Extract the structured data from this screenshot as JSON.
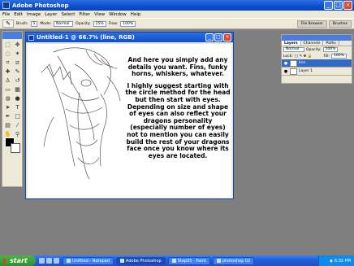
{
  "app": {
    "title": "Adobe Photoshop"
  },
  "menu": [
    "File",
    "Edit",
    "Image",
    "Layer",
    "Select",
    "Filter",
    "View",
    "Window",
    "Help"
  ],
  "options": {
    "brush_label": "Brush:",
    "brush_size": "5",
    "mode_label": "Mode:",
    "mode_value": "Normal",
    "opacity_label": "Opacity:",
    "opacity_value": "25%",
    "flow_label": "Flow:",
    "flow_value": "100%",
    "well_tabs": [
      "File Browser",
      "Brushes"
    ]
  },
  "document": {
    "title": "Untitled-1 @ 66.7% (line, RGB)",
    "paragraphs": [
      "And here you simply add any details you want. Fins, funky horns, whiskers, whatever.",
      "I highly suggest starting with the circle method for the head but then start with eyes. Depending on size and shape of eyes can also reflect your dragons personality (especially number of eyes)  not to mention you can easily build the rest of your dragons face once you know where its eyes are located."
    ]
  },
  "layers": {
    "tabs": [
      "Layers",
      "Channels",
      "Paths"
    ],
    "blend_mode": "Normal",
    "opacity_label": "Opacity:",
    "opacity_value": "100%",
    "lock_label": "Lock:",
    "fill_label": "Fill:",
    "fill_value": "100%",
    "items": [
      {
        "name": "line",
        "selected": true
      },
      {
        "name": "Layer 1",
        "selected": false
      }
    ]
  },
  "taskbar": {
    "start_label": "start",
    "tasks": [
      "Untitled - Notepad",
      "Adobe Photoshop",
      "Step05 - Paint",
      "photoshop 02"
    ],
    "active_task": "Adobe Photoshop",
    "clock": "6:32 PM"
  }
}
